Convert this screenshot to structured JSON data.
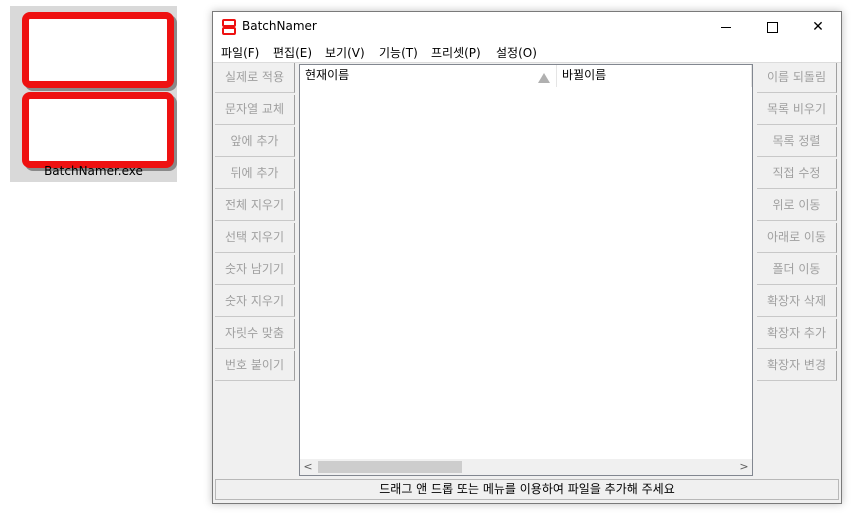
{
  "desktop_icon": {
    "label": "BatchNamer.exe"
  },
  "window": {
    "title": "BatchNamer",
    "controls": {
      "minimize": "—",
      "maximize": "☐",
      "close": "✕"
    }
  },
  "menu": [
    "파일(F)",
    "편집(E)",
    "보기(V)",
    "기능(T)",
    "프리셋(P)",
    "설정(O)"
  ],
  "left_buttons": [
    "실제로 적용",
    "문자열 교체",
    "앞에 추가",
    "뒤에 추가",
    "전체 지우기",
    "선택 지우기",
    "숫자 남기기",
    "숫자 지우기",
    "자릿수 맞춤",
    "번호 붙이기"
  ],
  "right_buttons": [
    "이름 되돌림",
    "목록 비우기",
    "목록 정렬",
    "직접 수정",
    "위로 이동",
    "아래로 이동",
    "폴더 이동",
    "확장자 삭제",
    "확장자 추가",
    "확장자 변경"
  ],
  "list": {
    "columns": [
      "현재이름",
      "바뀔이름"
    ],
    "scroll_left": "<",
    "scroll_right": ">"
  },
  "status": "드래그 앤 드롭 또는 메뉴를 이용하여 파일을 추가해 주세요",
  "colors": {
    "brand_red": "#ee1111",
    "disabled_text": "#a0a0a0"
  }
}
